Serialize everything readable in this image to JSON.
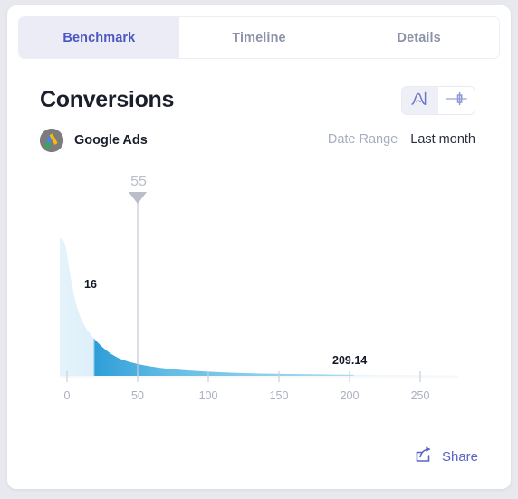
{
  "tabs": [
    {
      "label": "Benchmark",
      "active": true
    },
    {
      "label": "Timeline",
      "active": false
    },
    {
      "label": "Details",
      "active": false
    }
  ],
  "header": {
    "title": "Conversions",
    "source": "Google Ads",
    "date_range_label": "Date Range",
    "date_range_value": "Last month"
  },
  "view_toggle": {
    "distribution_icon": "distribution-curve-icon",
    "boxplot_icon": "box-plot-icon",
    "active": "distribution"
  },
  "footer": {
    "share_label": "Share",
    "share_icon": "share-icon"
  },
  "colors": {
    "accent": "#4c56c0",
    "curve_dark": "#2f9ed8",
    "curve_light": "#e8f4fb",
    "marker": "#b9bec9",
    "tab_active_bg": "#ebecf5"
  },
  "chart_data": {
    "type": "area",
    "title": "Conversions",
    "xlabel": "",
    "ylabel": "",
    "xlim": [
      0,
      280
    ],
    "ylim": [
      0,
      100
    ],
    "grid": false,
    "legend": "none",
    "ticks": [
      0,
      50,
      100,
      150,
      200,
      250
    ],
    "annotations": [
      {
        "name": "benchmark-marker",
        "label": "55",
        "x": 55
      },
      {
        "name": "lower-bound-label",
        "label": "16",
        "x": 16
      },
      {
        "name": "upper-bound-label",
        "label": "209.14",
        "x": 209.14
      }
    ],
    "highlight_range": [
      16,
      209.14
    ],
    "x": [
      0,
      5,
      10,
      16,
      22,
      30,
      40,
      50,
      60,
      70,
      85,
      100,
      120,
      140,
      160,
      180,
      200,
      209.14,
      230,
      250,
      265,
      280
    ],
    "y": [
      100,
      92,
      78,
      63,
      52,
      43,
      35,
      29,
      25,
      22,
      18,
      15,
      12,
      10,
      8.5,
      7.2,
      6.2,
      5.9,
      5.0,
      4.4,
      4.0,
      3.8
    ]
  }
}
